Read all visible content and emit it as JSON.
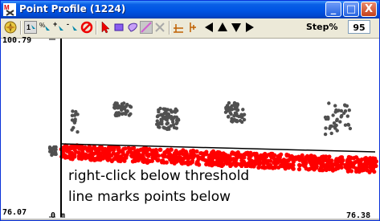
{
  "window": {
    "title": "Point Profile (1224)",
    "buttons": {
      "minimize": "_",
      "maximize": "□",
      "close": "X"
    }
  },
  "toolbar": {
    "tools": [
      "compass-tool-icon",
      "select-point-icon",
      "add-point-icon",
      "remove-point-icon",
      "clear-icon",
      "arrow-tool-icon",
      "rectangle-select-icon",
      "lasso-select-icon",
      "line-draw-icon",
      "delete-x-icon",
      "threshold-horizontal-icon",
      "threshold-vertical-icon",
      "arrow-left-icon",
      "arrow-up-icon",
      "arrow-down-icon",
      "arrow-right-icon"
    ],
    "step_label": "Step%",
    "step_value": "95"
  },
  "plot": {
    "y_max_label": "100.79",
    "y_min_label": "76.07",
    "x_min_label": "0 m",
    "x_max_label": "76.38"
  },
  "caption": {
    "line1": "right-click below threshold",
    "line2": "line marks points below"
  },
  "colors": {
    "marked_points": "#ff0000",
    "points": "#505050",
    "titlebar": "#0054e3"
  }
}
